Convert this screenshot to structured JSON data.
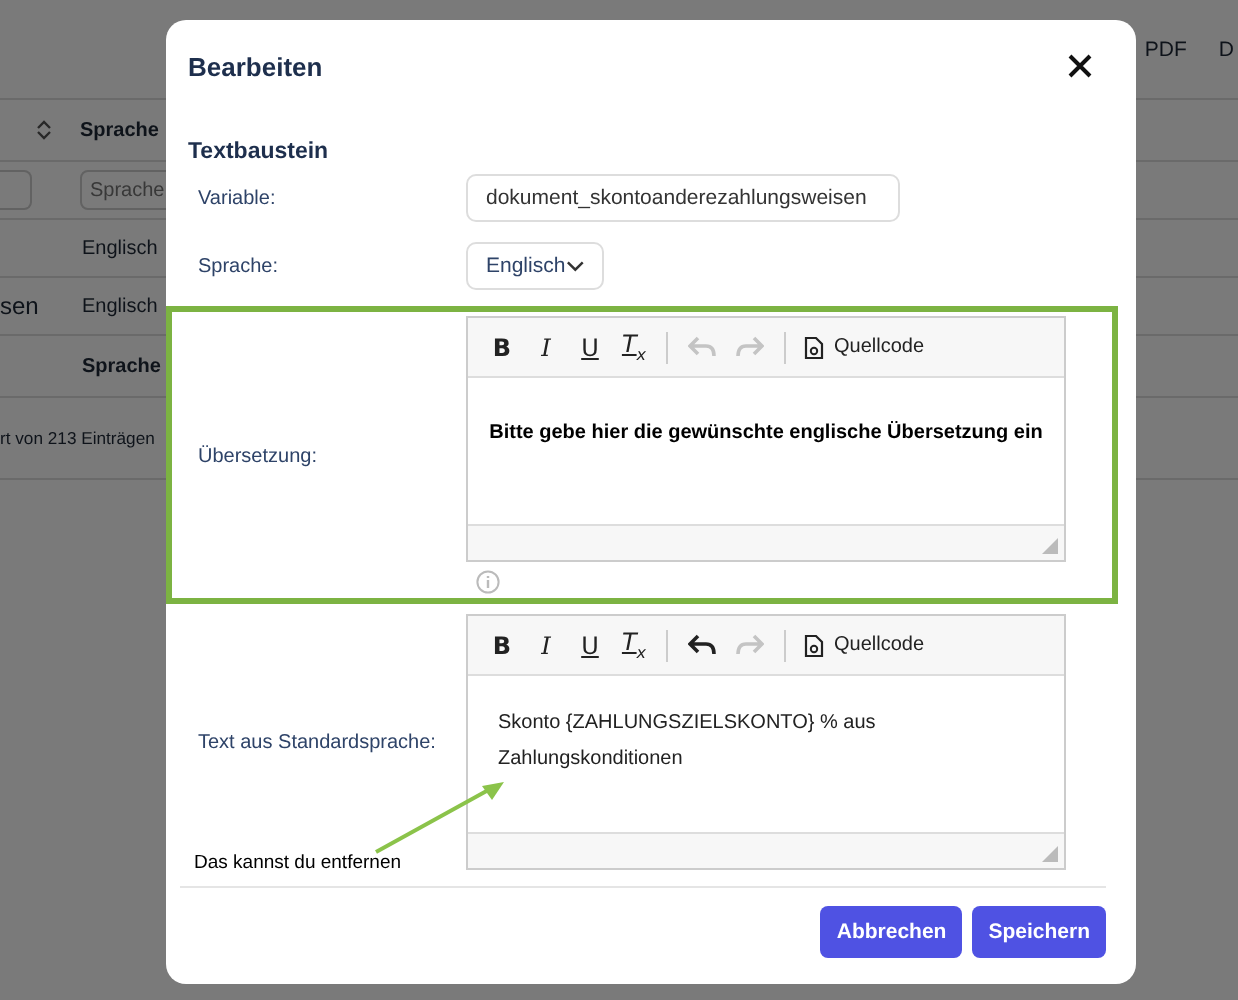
{
  "background": {
    "header_links": [
      "PDF",
      "D"
    ],
    "column_header": "Sprache",
    "filter_placeholder": "Sprache",
    "rows": [
      {
        "kind": "row",
        "column_1": "",
        "language": "Englisch"
      },
      {
        "kind": "row",
        "column_1": "sen",
        "language": "Englisch"
      },
      {
        "kind": "header",
        "column_1": "",
        "language": "Sprache"
      }
    ],
    "footer": "rt von 213 Einträgen"
  },
  "dialog": {
    "title": "Bearbeiten",
    "section_title": "Textbaustein",
    "variable": {
      "label": "Variable:",
      "value": "dokument_skontoanderezahlungsweisen"
    },
    "language": {
      "label": "Sprache:",
      "value": "Englisch"
    },
    "editors": [
      {
        "label": "Übersetzung:",
        "undo_disabled": true,
        "redo_disabled": true,
        "info": true,
        "highlighted": true,
        "toolbar": [
          {
            "kind": "bold",
            "label": "B"
          },
          {
            "kind": "italic",
            "label": "I"
          },
          {
            "kind": "underline",
            "label": "U"
          },
          {
            "kind": "clear",
            "label": "T$_{x}$"
          }
        ],
        "source_label": "Quellcode"
      },
      {
        "label": "Text aus Standardsprache:",
        "undo_disabled": false,
        "redo_disabled": true,
        "content": [
          "Skonto {ZAHLUNGSZIELSKONTO} % aus",
          "Zahlungskonditionen"
        ],
        "info": false,
        "highlighted": false,
        "toolbar": [
          {
            "kind": "bold",
            "label": "B"
          },
          {
            "kind": "italic",
            "label": "I"
          },
          {
            "kind": "underline",
            "label": "U"
          },
          {
            "kind": "clear",
            "label": "T$_{x}$"
          }
        ],
        "source_label": "Quellcode"
      }
    ],
    "buttons": [
      {
        "label": "Abbrechen"
      },
      {
        "label": "Speichern"
      }
    ]
  },
  "annotations": [
    {
      "kind": "overlay_text",
      "text": "Bitte gebe hier die gewünschte englische Übersetzung ein"
    },
    {
      "kind": "arrow_note",
      "text": "Das kannst du entfernen"
    }
  ]
}
